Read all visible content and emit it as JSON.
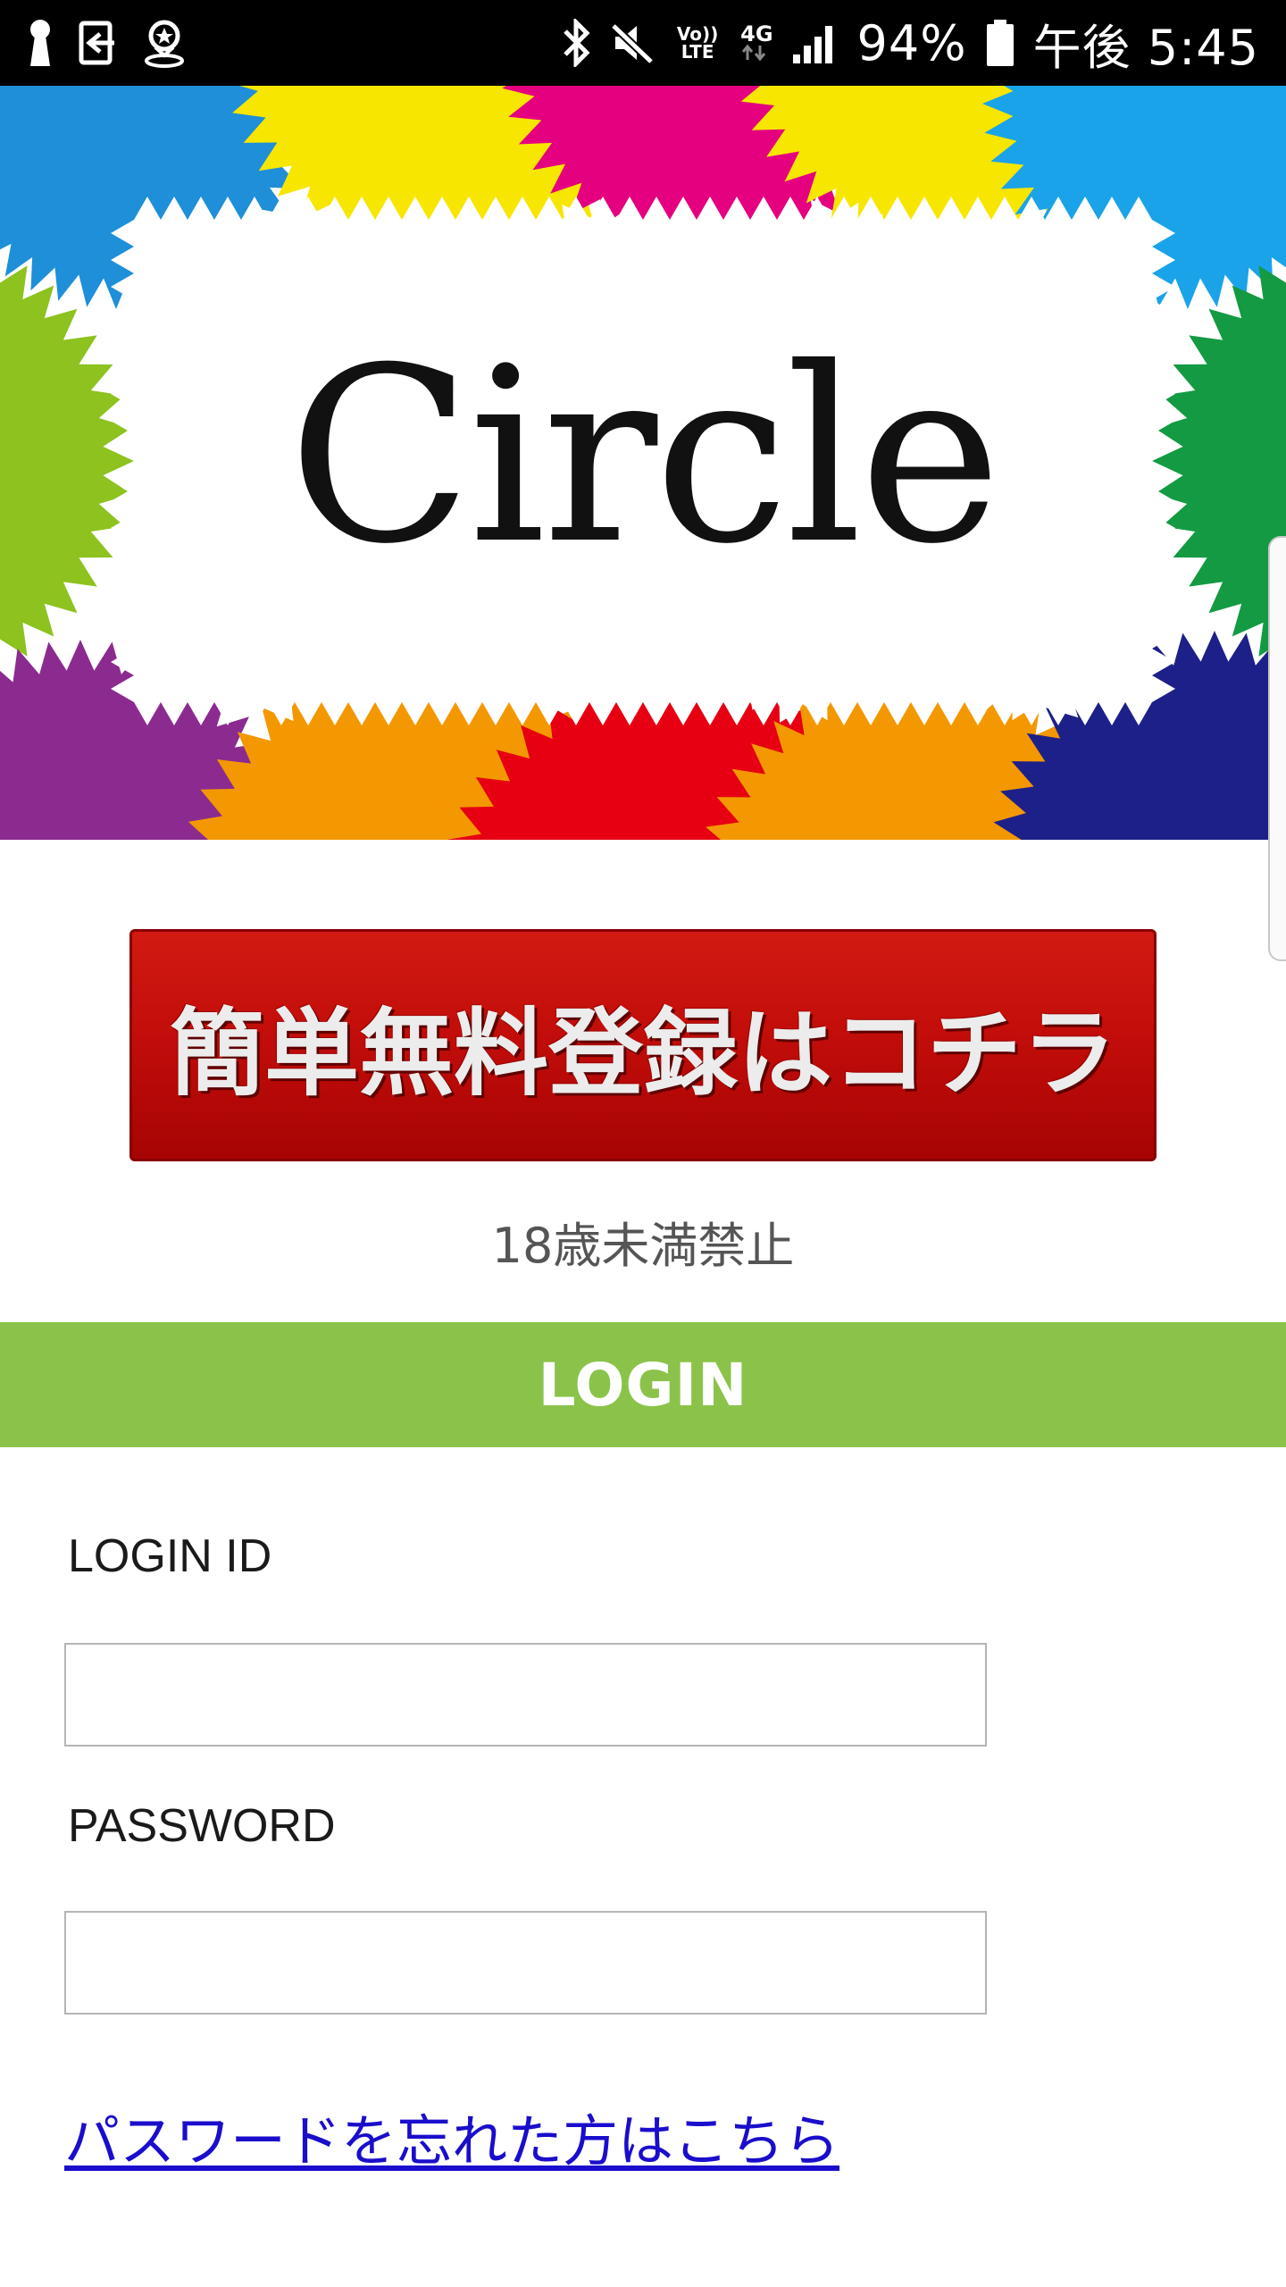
{
  "status_bar": {
    "battery_percent": "94%",
    "time": "午後 5:45",
    "network": "4G",
    "volte": "Vo)) LTE",
    "icons": [
      "keyhole-icon",
      "sign-in-icon",
      "location-icon",
      "bluetooth-icon",
      "mute-icon",
      "signal-icon",
      "battery-icon"
    ]
  },
  "banner": {
    "logo_text": "Circle",
    "colors": {
      "blue": "#1e8fd8",
      "yellow": "#f7e600",
      "magenta": "#e4007f",
      "cyan": "#1aa3e8",
      "lime": "#8dc21f",
      "green": "#139a43",
      "purple": "#8b2b8f",
      "orange": "#f39800",
      "red": "#e60012",
      "navy": "#1d2088"
    }
  },
  "register": {
    "button_label": "簡単無料登録はコチラ",
    "age_note": "18歳未満禁止"
  },
  "login": {
    "title": "LOGIN",
    "login_id_label": "LOGIN ID",
    "login_id_value": "",
    "password_label": "PASSWORD",
    "password_value": "",
    "forgot_password_link": "パスワードを忘れた方はこちら",
    "accent_color": "#8bc34a",
    "link_color": "#1a0dcc"
  }
}
